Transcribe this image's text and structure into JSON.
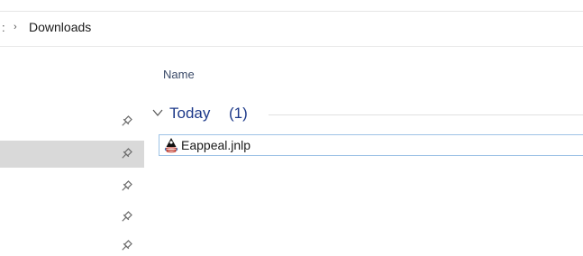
{
  "address_bar": {
    "prev_crumb": ":",
    "separator": "›",
    "current": "Downloads"
  },
  "nav_pane": {
    "pinned_items": [
      {
        "icon": "pin-icon",
        "selected": false
      },
      {
        "icon": "pin-icon",
        "selected": true
      },
      {
        "icon": "pin-icon",
        "selected": false
      },
      {
        "icon": "pin-icon",
        "selected": false
      },
      {
        "icon": "pin-icon",
        "selected": false
      }
    ]
  },
  "content": {
    "column_header": "Name",
    "group": {
      "title": "Today",
      "count": "(1)",
      "expanded_icon": "chevron-down-icon"
    },
    "files": [
      {
        "name": "Eappeal.jnlp",
        "icon": "java-icon",
        "selected": true
      }
    ]
  },
  "colors": {
    "group_text": "#1e3a8a",
    "selection_border": "#9ec3e6",
    "nav_selected_bg": "#d9d9d9"
  }
}
